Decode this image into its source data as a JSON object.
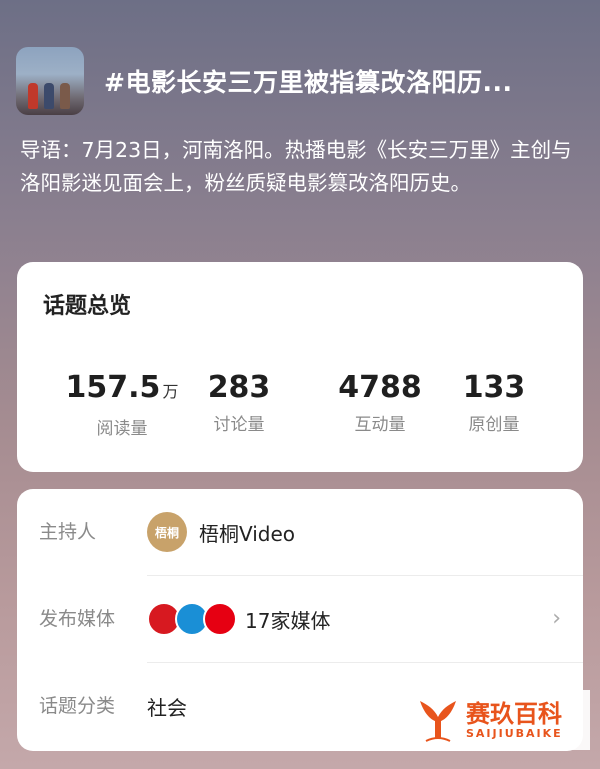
{
  "header": {
    "title": "#电影长安三万里被指篡改洛阳历...",
    "intro": "导语：7月23日，河南洛阳。热播电影《长安三万里》主创与洛阳影迷见面会上，粉丝质疑电影篡改洛阳历史。"
  },
  "overview": {
    "title": "话题总览",
    "stats": [
      {
        "value": "157.5",
        "unit": "万",
        "label": "阅读量"
      },
      {
        "value": "283",
        "unit": "",
        "label": "讨论量"
      },
      {
        "value": "4788",
        "unit": "",
        "label": "互动量"
      },
      {
        "value": "133",
        "unit": "",
        "label": "原创量"
      }
    ]
  },
  "info": {
    "host": {
      "label": "主持人",
      "avatar_text": "梧桐",
      "value": "梧桐Video"
    },
    "media": {
      "label": "发布媒体",
      "value": "17家媒体"
    },
    "category": {
      "label": "话题分类",
      "value": "社会"
    }
  },
  "watermark": {
    "cn": "赛玖百科",
    "en": "SAIJIUBAIKE"
  },
  "colors": {
    "accent": "#e8541c"
  }
}
